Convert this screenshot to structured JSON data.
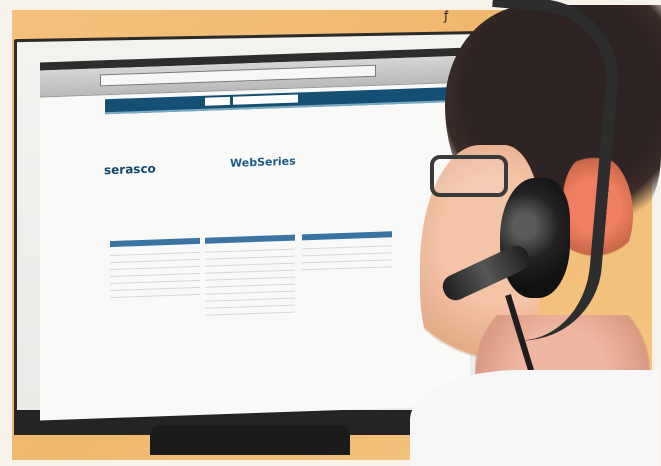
{
  "brand": "serasco",
  "brand_right": "WebSeries"
}
